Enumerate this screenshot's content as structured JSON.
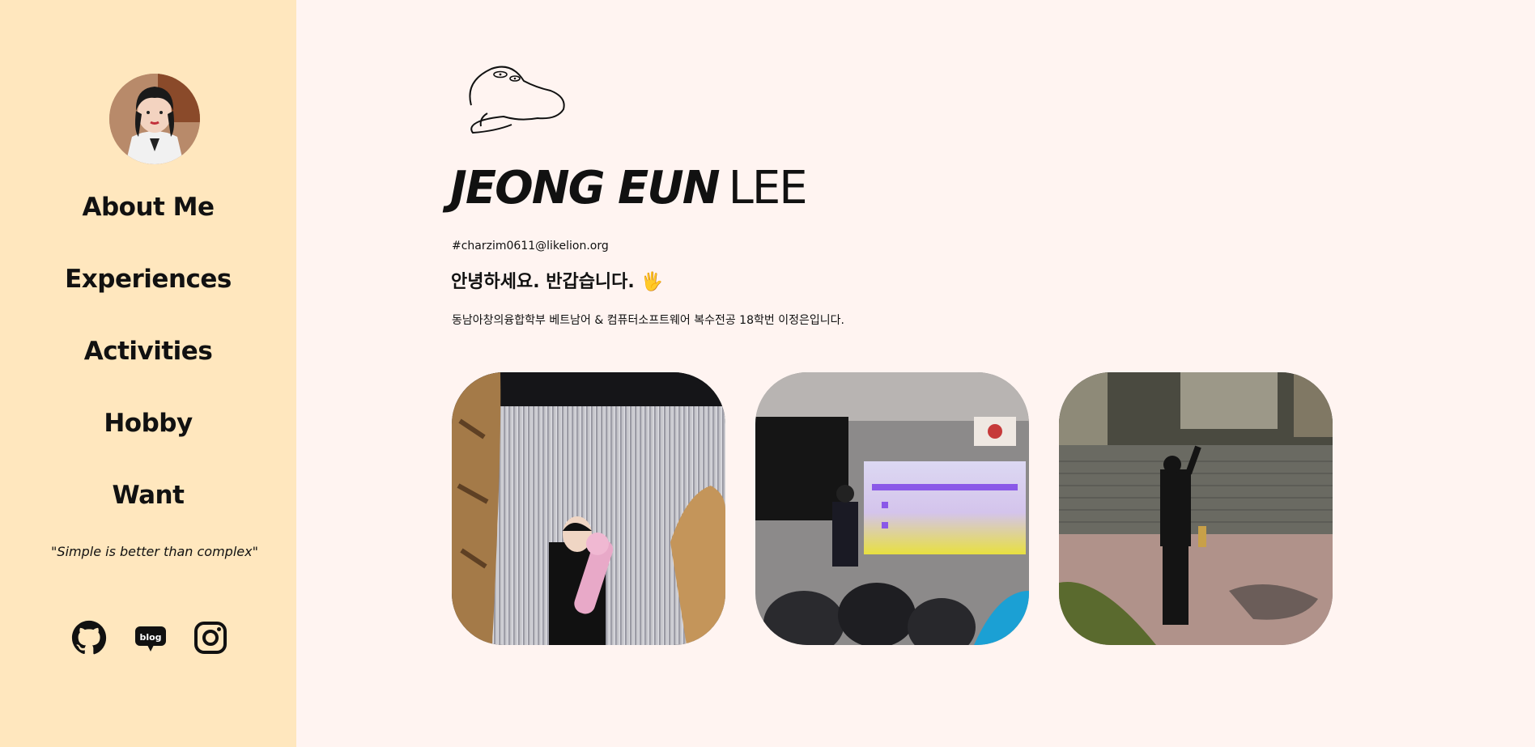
{
  "sidebar": {
    "nav": [
      {
        "label": "About Me"
      },
      {
        "label": "Experiences"
      },
      {
        "label": "Activities"
      },
      {
        "label": "Hobby"
      },
      {
        "label": "Want"
      }
    ],
    "quote": "\"Simple is better than complex\"",
    "social": [
      {
        "icon": "github-icon"
      },
      {
        "icon": "blog-icon",
        "label": "blog"
      },
      {
        "icon": "instagram-icon"
      }
    ]
  },
  "main": {
    "name_first": "JEONG EUN",
    "name_last": "LEE",
    "email": "#charzim0611@likelion.org",
    "greeting": "안녕하세요. 반갑습니다.",
    "greeting_emoji": "🖐",
    "intro": "동남아창의융합학부 베트남어 & 컴퓨터소프트웨어 복수전공 18학번 이정은입니다."
  },
  "colors": {
    "sidebar_bg": "#ffe7be",
    "main_bg": "#fff4f1",
    "text": "#111111"
  }
}
